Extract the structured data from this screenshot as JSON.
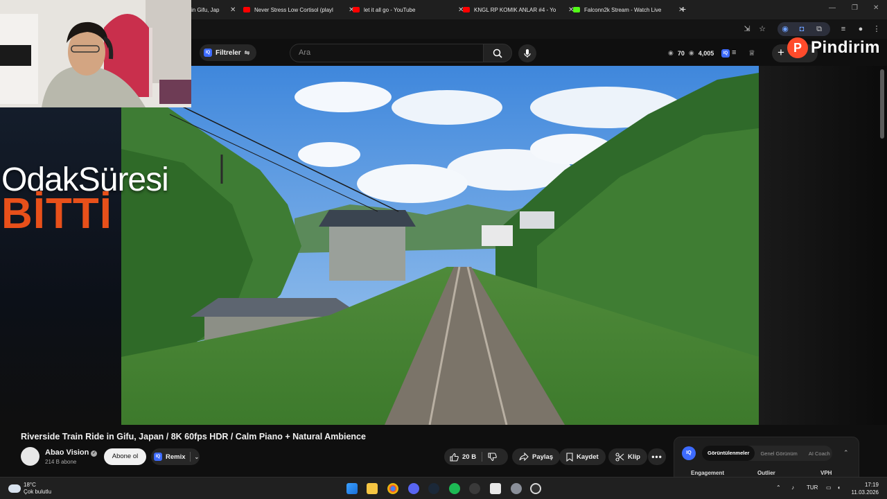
{
  "browser": {
    "tabs": [
      {
        "title": "in Gifu, Jap",
        "favicon_color": "#ff0000"
      },
      {
        "title": "Never Stress Low Cortisol (playl",
        "favicon_color": "#ff0000"
      },
      {
        "title": "let it all go - YouTube",
        "favicon_color": "#ff0000"
      },
      {
        "title": "KNGL RP KOMIK ANLAR #4 - Yo",
        "favicon_color": "#ff0000"
      },
      {
        "title": "Falconn2k Stream - Watch Live",
        "favicon_color": "#53fc18"
      }
    ],
    "new_tab_icon": "plus-icon"
  },
  "youtube": {
    "filters_label": "Filtreler",
    "search_placeholder": "Ara",
    "stats": {
      "views_a": "70",
      "views_b": "4,005"
    },
    "brand_overlay": "Pindirim",
    "brand_initial": "P"
  },
  "overlay": {
    "line1": "OdakSüresi",
    "line2": "BİTTİ"
  },
  "video": {
    "title": "Riverside Train Ride in Gifu, Japan / 8K 60fps HDR / Calm Piano + Natural Ambience",
    "channel": "Abao Vision",
    "subscribers": "214 B abone",
    "subscribe_label": "Abone ol",
    "remix_label": "Remix",
    "likes": "20 B",
    "share_label": "Paylaş",
    "save_label": "Kaydet",
    "clip_label": "Klip"
  },
  "ai_panel": {
    "logo": "IQ",
    "tabs": [
      "Görüntülenmeler",
      "Genel Görünüm",
      "AI Coach"
    ],
    "active_tab": "Görüntülenmeler",
    "columns": [
      "Engagement",
      "Outlier",
      "VPH"
    ]
  },
  "taskbar": {
    "temperature": "18°C",
    "condition": "Çok bulutlu",
    "language": "TUR",
    "time": "17:19",
    "date": "11.03.2026"
  },
  "colors": {
    "accent_orange": "#e8501a",
    "iq_blue": "#3d6bff",
    "youtube_red": "#ff0000"
  }
}
